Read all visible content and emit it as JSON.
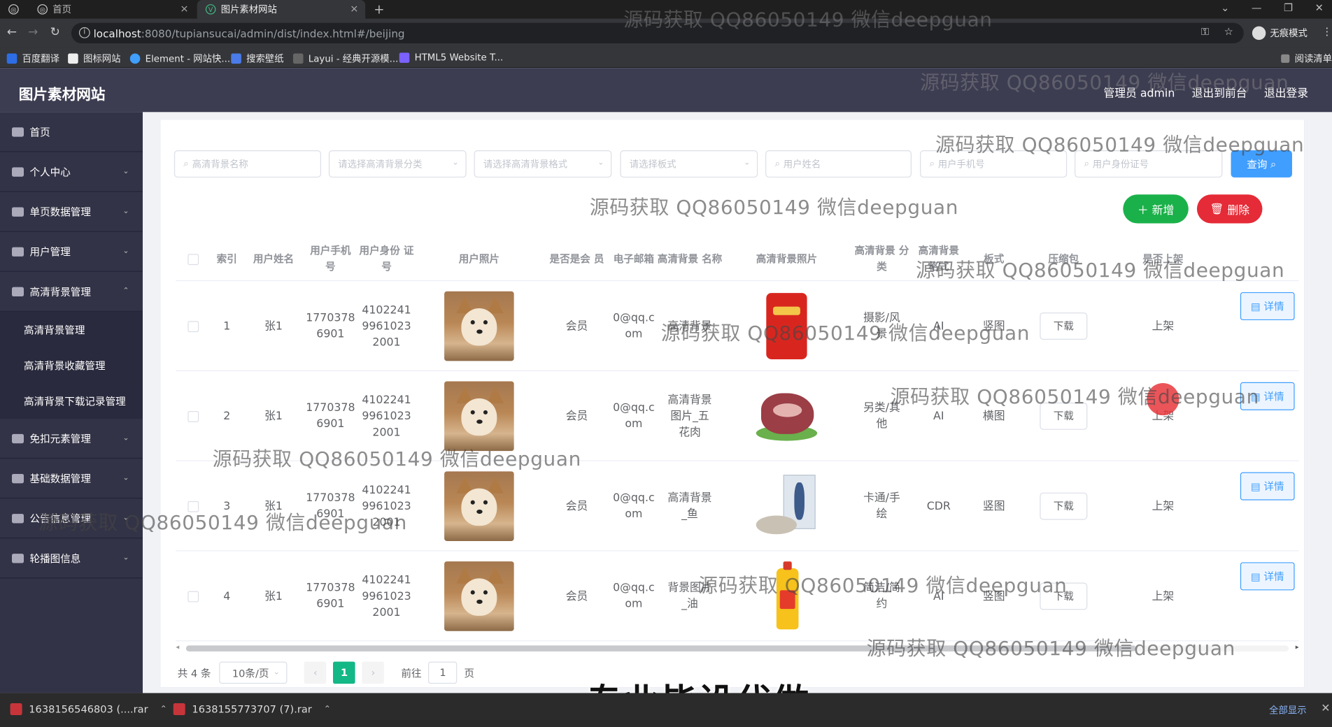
{
  "browser": {
    "tabs": [
      {
        "label": "首页",
        "active": false
      },
      {
        "label": "图片素材网站",
        "active": true
      }
    ],
    "url_host": "localhost",
    "url_rest": ":8080/tupiansucai/admin/dist/index.html#/beijing",
    "incognito_label": "无痕模式",
    "bookmarks": [
      "百度翻译",
      "图标网站",
      "Element - 网站快...",
      "搜索壁纸",
      "Layui - 经典开源模...",
      "HTML5 Website T..."
    ],
    "reading_list": "阅读清单"
  },
  "header": {
    "site_title": "图片素材网站",
    "user_label": "管理员 admin",
    "to_front": "退出到前台",
    "logout": "退出登录"
  },
  "sidebar": {
    "items": [
      {
        "label": "首页",
        "icon": "home-icon"
      },
      {
        "label": "个人中心",
        "icon": "user-icon"
      },
      {
        "label": "单页数据管理",
        "icon": "list-icon"
      },
      {
        "label": "用户管理",
        "icon": "clock-icon"
      },
      {
        "label": "高清背景管理",
        "icon": "image-icon",
        "expanded": true
      },
      {
        "label": "免扣元素管理",
        "icon": "element-icon"
      },
      {
        "label": "基础数据管理",
        "icon": "data-icon"
      },
      {
        "label": "公告信息管理",
        "icon": "notice-icon"
      },
      {
        "label": "轮播图信息",
        "icon": "carousel-icon"
      }
    ],
    "subitems": [
      "高清背景管理",
      "高清背景收藏管理",
      "高清背景下载记录管理"
    ]
  },
  "search": {
    "name_placeholder": "高清背景名称",
    "category_placeholder": "请选择高清背景分类",
    "format_placeholder": "请选择高清背景格式",
    "layout_placeholder": "请选择板式",
    "user_name_placeholder": "用户姓名",
    "phone_placeholder": "用户手机号",
    "id_card_placeholder": "用户身份证号",
    "query_label": "查询"
  },
  "actions": {
    "add_label": "新增",
    "delete_label": "删除"
  },
  "table": {
    "headers": [
      "索引",
      "用户姓名",
      "用户手机\n号",
      "用户身份\n证号",
      "用户照片",
      "是否是会\n员",
      "电子邮箱",
      "高清背景\n名称",
      "高清背景照片",
      "高清背景\n分类",
      "高清背景\n格式",
      "板式",
      "压缩包",
      "是否上架"
    ],
    "rows": [
      {
        "index": "1",
        "name": "张1",
        "phone": "1770378\n6901",
        "id_card": "4102241\n9961023\n2001",
        "member": "会员",
        "email": "0@qq.c\nom",
        "bg_name": "高清背景",
        "category": "摄影/风\n景",
        "format": "AI",
        "layout": "竖图",
        "download": "下载",
        "status": "上架",
        "detail": "详情"
      },
      {
        "index": "2",
        "name": "张1",
        "phone": "1770378\n6901",
        "id_card": "4102241\n9961023\n2001",
        "member": "会员",
        "email": "0@qq.c\nom",
        "bg_name": "高清背景\n图片_五\n花肉",
        "category": "另类/其\n他",
        "format": "AI",
        "layout": "横图",
        "download": "下载",
        "status": "上架",
        "detail": "详情"
      },
      {
        "index": "3",
        "name": "张1",
        "phone": "1770378\n6901",
        "id_card": "4102241\n9961023\n2001",
        "member": "会员",
        "email": "0@qq.c\nom",
        "bg_name": "高清背景\n_鱼",
        "category": "卡通/手\n绘",
        "format": "CDR",
        "layout": "竖图",
        "download": "下载",
        "status": "上架",
        "detail": "详情"
      },
      {
        "index": "4",
        "name": "张1",
        "phone": "1770378\n6901",
        "id_card": "4102241\n9961023\n2001",
        "member": "会员",
        "email": "0@qq.c\nom",
        "bg_name": "背景图片\n_油",
        "category": "简洁/简\n约",
        "format": "AI",
        "layout": "竖图",
        "download": "下载",
        "status": "上架",
        "detail": "详情"
      }
    ]
  },
  "pagination": {
    "total": "共 4 条",
    "page_size": "10条/页",
    "current": "1",
    "goto_prefix": "前往",
    "goto_value": "1",
    "goto_suffix": "页"
  },
  "watermark": "源码获取 QQ86050149 微信deepguan",
  "caption": "专业毕设代做",
  "downloads": {
    "files": [
      "1638156546803 (....rar",
      "1638155773707 (7).rar"
    ],
    "show_all": "全部显示"
  }
}
